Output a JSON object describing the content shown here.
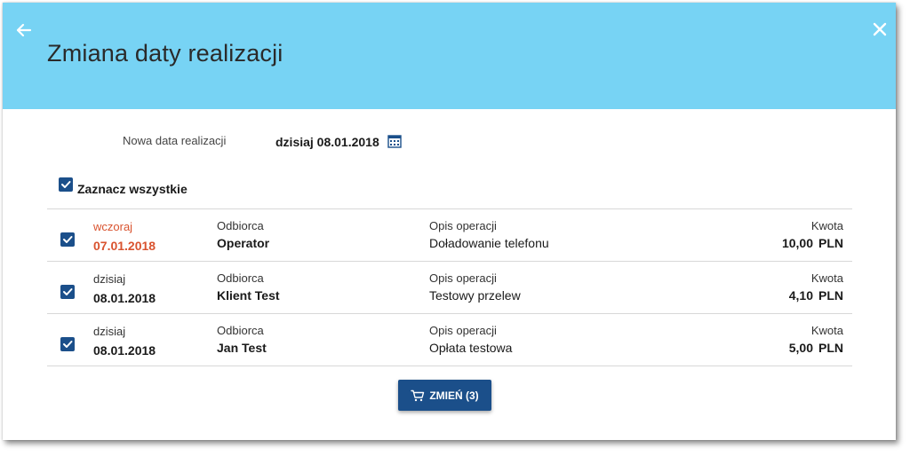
{
  "header": {
    "title": "Zmiana daty realizacji",
    "background": "#77d3f4",
    "back_icon": "arrow-left-icon",
    "close_icon": "close-icon"
  },
  "date_field": {
    "label": "Nowa data realizacji",
    "value": "dzisiaj 08.01.2018",
    "icon": "calendar-icon"
  },
  "select_all": {
    "label": "Zaznacz wszystkie",
    "checked": true
  },
  "rows": [
    {
      "checked": true,
      "day": "wczoraj",
      "date": "07.01.2018",
      "recipient_label": "Odbiorca",
      "recipient": "Operator",
      "description_label": "Opis operacji",
      "description": "Doładowanie telefonu",
      "amount_label": "Kwota",
      "amount": "10,00",
      "currency": "PLN"
    },
    {
      "checked": true,
      "day": "dzisiaj",
      "date": "08.01.2018",
      "recipient_label": "Odbiorca",
      "recipient": "Klient Test",
      "description_label": "Opis operacji",
      "description": "Testowy przelew",
      "amount_label": "Kwota",
      "amount": "4,10",
      "currency": "PLN"
    },
    {
      "checked": true,
      "day": "dzisiaj",
      "date": "08.01.2018",
      "recipient_label": "Odbiorca",
      "recipient": "Jan Test",
      "description_label": "Opis operacji",
      "description": "Opłata testowa",
      "amount_label": "Kwota",
      "amount": "5,00",
      "currency": "PLN"
    }
  ],
  "change_button": {
    "label": "ZMIEŃ (3)",
    "icon": "cart-icon"
  },
  "colors": {
    "accent": "#1b4f8a",
    "past_date": "#d9532f"
  }
}
